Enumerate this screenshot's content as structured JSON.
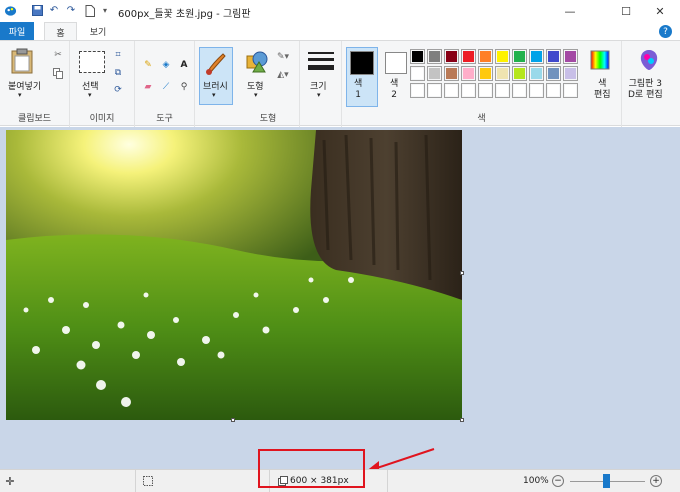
{
  "titlebar": {
    "title": "600px_들꽃 초원.jpg - 그림판",
    "icons": [
      "paint-app-icon",
      "save-icon",
      "undo-icon",
      "redo-icon",
      "new-file-icon",
      "quick-access-dropdown-icon"
    ],
    "minimize": "—",
    "maximize": "☐",
    "close": "✕"
  },
  "tabs": {
    "file": "파일",
    "home": "홈",
    "view": "보기"
  },
  "ribbon": {
    "clipboard": {
      "paste": "붙여넣기",
      "label": "클립보드"
    },
    "image": {
      "select": "선택",
      "label": "이미지"
    },
    "tools": {
      "label": "도구"
    },
    "brushes": {
      "label": "브러시"
    },
    "shapes": {
      "shapes": "도형",
      "label": "도형"
    },
    "size": {
      "label": "크기"
    },
    "colors": {
      "color1": "색\n1",
      "color2": "색\n2",
      "label": "색",
      "edit_colors": "색\n편집",
      "paint3d": "그림판 3\nD로 편집",
      "palette_row1": [
        "#000000",
        "#7f7f7f",
        "#880015",
        "#ed1c24",
        "#ff7f27",
        "#fff200",
        "#22b14c",
        "#00a2e8",
        "#3f48cc",
        "#a349a4"
      ],
      "palette_row2": [
        "#ffffff",
        "#c3c3c3",
        "#b97a57",
        "#ffaec9",
        "#ffc90e",
        "#efe4b0",
        "#b5e61d",
        "#99d9ea",
        "#7092be",
        "#c8bfe7"
      ],
      "palette_row3": [
        "#ffffff",
        "#ffffff",
        "#ffffff",
        "#ffffff",
        "#ffffff",
        "#ffffff",
        "#ffffff",
        "#ffffff",
        "#ffffff",
        "#ffffff"
      ]
    }
  },
  "status": {
    "image_size": "600 × 381px",
    "zoom": "100%"
  }
}
